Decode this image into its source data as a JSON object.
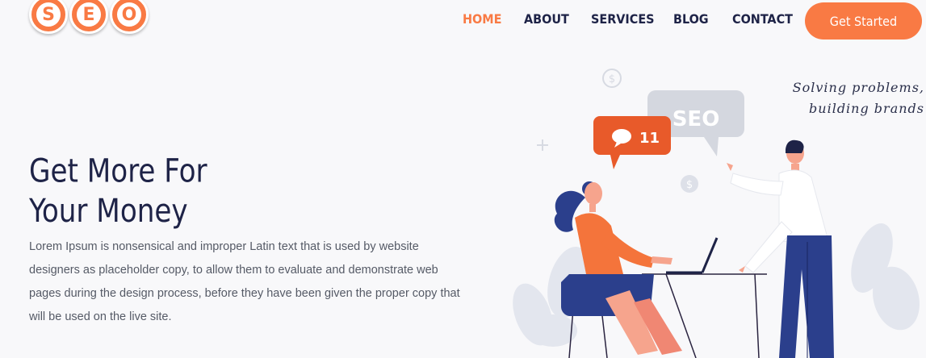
{
  "logo": {
    "letters": [
      "S",
      "E",
      "O"
    ]
  },
  "nav": {
    "items": [
      "HOME",
      "ABOUT",
      "SERVICES",
      "BLOG",
      "CONTACT"
    ],
    "active": "HOME",
    "cta": "Get Started"
  },
  "hero": {
    "title_line1": "Get More For",
    "title_line2": "Your Money",
    "description": "Lorem Ipsum is nonsensical and improper Latin text that is used by website designers as placeholder copy, to allow them to evaluate and demonstrate web pages during the design process, before they have been given the proper copy that will be used on the live site."
  },
  "illustration": {
    "seo_bubble": "SEO",
    "notification_count": "11",
    "tagline_line1": "Solving problems,",
    "tagline_line2": "building brands",
    "icons": [
      "dollar-icon",
      "dollar-icon",
      "plus-icon",
      "chat-bubble-icon",
      "laptop-icon"
    ]
  },
  "colors": {
    "accent": "#f97a44",
    "navy": "#1e2347",
    "background": "#f8f8fa"
  }
}
